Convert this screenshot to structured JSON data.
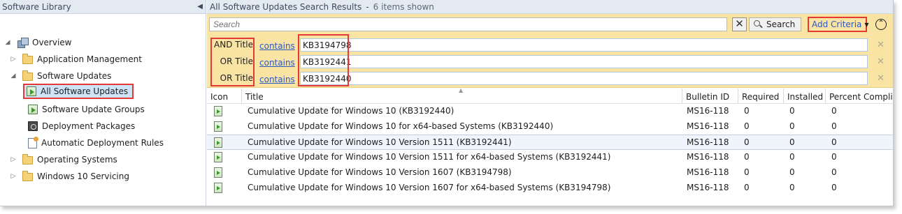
{
  "nav": {
    "header": "Software Library",
    "items": [
      {
        "label": "Overview",
        "icon": "overview-icon"
      },
      {
        "label": "Application Management",
        "icon": "folder-icon"
      },
      {
        "label": "Software Updates",
        "icon": "folder-icon"
      },
      {
        "label": "All Software Updates",
        "icon": "software-update-icon"
      },
      {
        "label": "Software Update Groups",
        "icon": "software-update-group-icon"
      },
      {
        "label": "Deployment Packages",
        "icon": "package-icon"
      },
      {
        "label": "Automatic Deployment Rules",
        "icon": "rule-icon"
      },
      {
        "label": "Operating Systems",
        "icon": "folder-icon"
      },
      {
        "label": "Windows 10 Servicing",
        "icon": "folder-icon"
      }
    ]
  },
  "main": {
    "title": "All Software Updates Search Results",
    "separator": "-",
    "count": "6 items shown"
  },
  "search": {
    "placeholder": "Search",
    "clear_label": "✕",
    "search_label": "Search",
    "add_criteria_label": "Add Criteria",
    "collapse_label": "⌃"
  },
  "criteria": [
    {
      "field": "AND Title",
      "operator": "contains",
      "value": "KB3194798"
    },
    {
      "field": "OR Title",
      "operator": "contains",
      "value": "KB3192441"
    },
    {
      "field": "OR Title",
      "operator": "contains",
      "value": "KB3192440"
    }
  ],
  "table": {
    "columns": [
      "Icon",
      "Title",
      "Bulletin ID",
      "Required",
      "Installed",
      "Percent Complian"
    ],
    "rows": [
      {
        "title": "Cumulative Update for Windows 10 (KB3192440)",
        "bulletin": "MS16-118",
        "required": "0",
        "installed": "0",
        "percent": "0"
      },
      {
        "title": "Cumulative Update for Windows 10 for x64-based Systems (KB3192440)",
        "bulletin": "MS16-118",
        "required": "0",
        "installed": "0",
        "percent": "0"
      },
      {
        "title": "Cumulative Update for Windows 10 Version 1511 (KB3192441)",
        "bulletin": "MS16-118",
        "required": "0",
        "installed": "0",
        "percent": "0"
      },
      {
        "title": "Cumulative Update for Windows 10 Version 1511 for x64-based Systems (KB3192441)",
        "bulletin": "MS16-118",
        "required": "0",
        "installed": "0",
        "percent": "0"
      },
      {
        "title": "Cumulative Update for Windows 10 Version 1607 (KB3194798)",
        "bulletin": "MS16-118",
        "required": "0",
        "installed": "0",
        "percent": "0"
      },
      {
        "title": "Cumulative Update for Windows 10 Version 1607 for x64-based Systems (KB3194798)",
        "bulletin": "MS16-118",
        "required": "0",
        "installed": "0",
        "percent": "0"
      }
    ]
  },
  "colors": {
    "filter_bg": "#f9e4a4",
    "highlight_border": "#e53935",
    "link": "#2a57c4",
    "header_bg": "#e4eaf2"
  }
}
